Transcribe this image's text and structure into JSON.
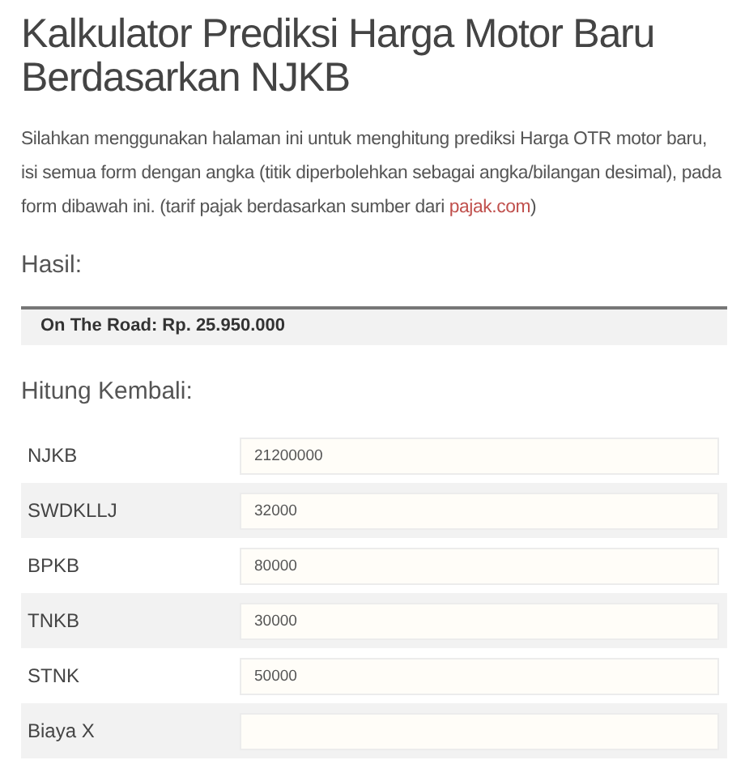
{
  "title": "Kalkulator Prediksi Harga Motor Baru Berdasarkan NJKB",
  "intro": {
    "text": "Silahkan menggunakan halaman ini untuk menghitung prediksi Harga OTR motor baru, isi semua form dengan angka (titik diperbolehkan sebagai angka/bilangan desimal), pada form dibawah ini. (tarif pajak berdasarkan sumber dari",
    "link": "pajak.com",
    "after": ")"
  },
  "result_heading": "Hasil:",
  "result": "On The Road: Rp. 25.950.000",
  "form_heading": "Hitung Kembali:",
  "fields": [
    {
      "label": "NJKB",
      "value": "21200000"
    },
    {
      "label": "SWDKLLJ",
      "value": "32000"
    },
    {
      "label": "BPKB",
      "value": "80000"
    },
    {
      "label": "TNKB",
      "value": "30000"
    },
    {
      "label": "STNK",
      "value": "50000"
    },
    {
      "label": "Biaya X"
    }
  ]
}
